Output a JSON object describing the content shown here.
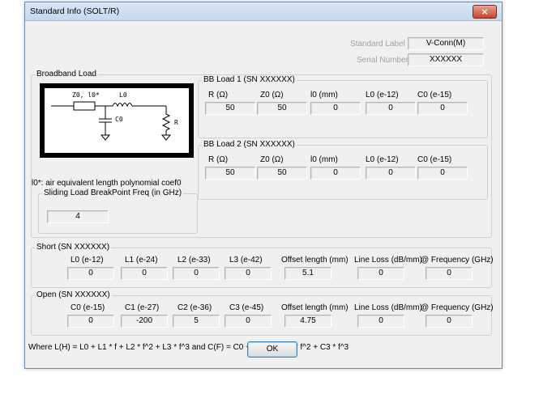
{
  "window": {
    "title": "Standard Info (SOLT/R)",
    "close_glyph": "×"
  },
  "standard": {
    "label_caption": "Standard Label",
    "label_value": "V-Conn(M)",
    "serial_caption": "Serial Number",
    "serial_value": "XXXXXX"
  },
  "broadband": {
    "group_title": "Broadband Load",
    "schematic": {
      "z0_label": "Z0, l0*",
      "l0_label": "L0",
      "c0_label": "C0",
      "r_label": "R"
    },
    "note": "l0*: air equivalent length polynomial coef0",
    "load1": {
      "title": "BB Load 1 (SN XXXXXX)",
      "headers": [
        "R (Ω)",
        "Z0 (Ω)",
        "l0 (mm)",
        "L0 (e-12)",
        "C0 (e-15)"
      ],
      "values": [
        "50",
        "50",
        "0",
        "0",
        "0"
      ]
    },
    "load2": {
      "title": "BB Load 2 (SN XXXXXX)",
      "headers": [
        "R (Ω)",
        "Z0 (Ω)",
        "l0 (mm)",
        "L0 (e-12)",
        "C0 (e-15)"
      ],
      "values": [
        "50",
        "50",
        "0",
        "0",
        "0"
      ]
    }
  },
  "sliding": {
    "title": "Sliding Load BreakPoint Freq (in GHz)",
    "value": "4"
  },
  "short": {
    "title": "Short (SN XXXXXX)",
    "headers": [
      "L0 (e-12)",
      "L1 (e-24)",
      "L2 (e-33)",
      "L3 (e-42)",
      "Offset length (mm)",
      "Line Loss (dB/mm)",
      "@ Frequency (GHz)"
    ],
    "values": [
      "0",
      "0",
      "0",
      "0",
      "5.1",
      "0",
      "0"
    ]
  },
  "open": {
    "title": "Open (SN XXXXXX)",
    "headers": [
      "C0 (e-15)",
      "C1 (e-27)",
      "C2 (e-36)",
      "C3 (e-45)",
      "Offset length (mm)",
      "Line Loss (dB/mm)",
      "@ Frequency (GHz)"
    ],
    "values": [
      "0",
      "-200",
      "5",
      "0",
      "4.75",
      "0",
      "0"
    ]
  },
  "formula": "Where L(H) = L0 + L1 * f + L2 * f^2 + L3 * f^3  and  C(F) = C0 + C1 * f + C2 * f^2 + C3 * f^3",
  "ok_label": "OK",
  "icons": {
    "close": "close-icon",
    "schematic": "circuit-schematic-icon"
  }
}
